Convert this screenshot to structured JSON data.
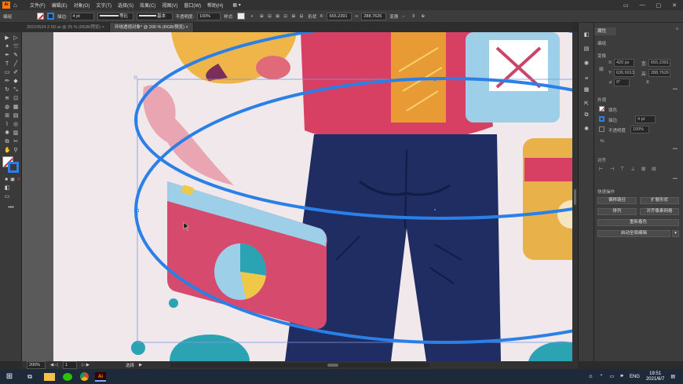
{
  "menubar": {
    "items": [
      "文件(F)",
      "编辑(E)",
      "对象(O)",
      "文字(T)",
      "选择(S)",
      "效果(C)",
      "视图(V)",
      "窗口(W)",
      "帮助(H)"
    ]
  },
  "control_bar": {
    "label_group": "编组",
    "stroke_label": "描边:",
    "stroke_weight": "4 pt",
    "stroke_profile": "等比",
    "brush": "基本",
    "opacity_label": "不透明度:",
    "opacity_value": "100%",
    "style_label": "样式:",
    "shape_label": "形状",
    "x_value": "655.2391",
    "w_value": "288.7626",
    "transform_label": "变换"
  },
  "tabs": [
    {
      "label": "20210524 2.5D.ai @ 25 % (RGB/预览)",
      "close": "×"
    },
    {
      "label": "环绕透视对象* @ 200 % (RGB/预览)",
      "close": "×"
    }
  ],
  "canvas": {
    "colors": {
      "bg": "#f0e8ea",
      "ring": "#2b80e8",
      "jeans": "#1f2d63",
      "jacket": "#d84063",
      "card": "#e8b14a",
      "lightblue": "#9ecfe8",
      "teal": "#2ba3b3"
    }
  },
  "panel": {
    "tab": "属性",
    "section_group": "编组",
    "section_transform": "变换",
    "x_label": "X:",
    "x_value": "420 px",
    "y_label": "Y:",
    "y_value": "636.6913",
    "w_label": "宽:",
    "w_value": "655.2391",
    "h_label": "高:",
    "h_value": "288.7626",
    "angle_value": "0°",
    "section_appearance": "外观",
    "fill_label": "填色",
    "stroke_label": "描边",
    "stroke_value": "4 pt",
    "opacity_label": "不透明度",
    "opacity_value": "100%",
    "fx_label": "fx.",
    "section_align": "对齐",
    "section_quick": "快速操作",
    "btn_offset": "偏移路径",
    "btn_expand": "扩展形状",
    "btn_arrange": "排列",
    "btn_pixel": "对齐像素网格",
    "btn_recolor": "重新着色",
    "btn_global": "启动全局编辑"
  },
  "status": {
    "zoom": "200%",
    "artboard": "1",
    "tool": "选择"
  },
  "taskbar": {
    "ime": "ENG",
    "time": "19:51",
    "date": "2021/6/7"
  }
}
